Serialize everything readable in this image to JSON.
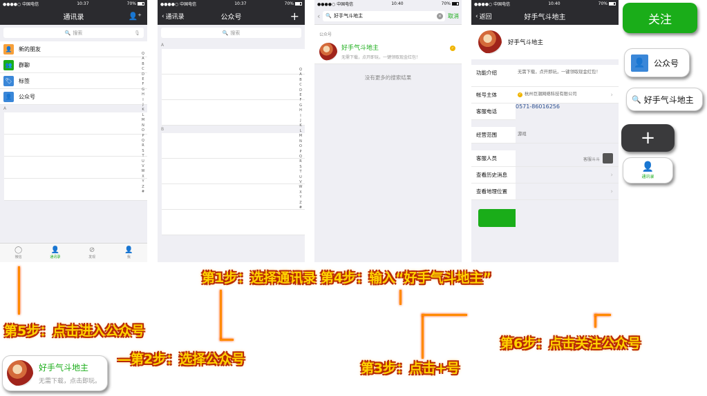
{
  "status": {
    "carrier": "●●●●○ 中国电信",
    "time1": "10:37",
    "time3": "10:40",
    "battery": "70%"
  },
  "screen1": {
    "title": "通讯录",
    "search_placeholder": "搜索",
    "rows": [
      {
        "label": "新的朋友",
        "color": "#f7a03a",
        "icon": "person-plus-icon",
        "glyph": "👤"
      },
      {
        "label": "群聊",
        "color": "#1aad19",
        "icon": "group-icon",
        "glyph": "👥"
      },
      {
        "label": "标签",
        "color": "#3a87d8",
        "icon": "tag-icon",
        "glyph": "🏷"
      },
      {
        "label": "公众号",
        "color": "#3a87d8",
        "icon": "official-account-icon",
        "glyph": "👤"
      }
    ],
    "section_a": "A",
    "alpha_index": [
      "Q",
      "A",
      "B",
      "C",
      "D",
      "E",
      "F",
      "G",
      "H",
      "I",
      "J",
      "K",
      "L",
      "M",
      "N",
      "O",
      "P",
      "Q",
      "R",
      "S",
      "T",
      "U",
      "V",
      "W",
      "X",
      "Y",
      "Z",
      "#"
    ],
    "tabs": [
      {
        "label": "微信",
        "icon": "chat-bubble-icon",
        "glyph": "◯"
      },
      {
        "label": "通讯录",
        "icon": "contacts-icon",
        "glyph": "👤"
      },
      {
        "label": "发现",
        "icon": "compass-icon",
        "glyph": "⊘"
      },
      {
        "label": "我",
        "icon": "me-icon",
        "glyph": "👤"
      }
    ]
  },
  "screen2": {
    "back": "通讯录",
    "title": "公众号",
    "add": "+",
    "search_placeholder": "搜索",
    "section_a": "A",
    "section_b": "B",
    "alpha_index": [
      "Q",
      "A",
      "B",
      "C",
      "D",
      "E",
      "F",
      "G",
      "H",
      "I",
      "J",
      "K",
      "L",
      "M",
      "N",
      "O",
      "P",
      "Q",
      "R",
      "S",
      "T",
      "U",
      "V",
      "W",
      "X",
      "Y",
      "Z",
      "#"
    ]
  },
  "screen3": {
    "query": "好手气斗地主",
    "cancel": "取消",
    "section": "公众号",
    "result_title": "好手气斗地主",
    "result_desc": "无需下载，点开即玩，一键领取现金红包！",
    "no_more": "没有更多的搜索结果"
  },
  "screen4": {
    "back": "返回",
    "title": "好手气斗地主",
    "name": "好手气斗地主",
    "rows": {
      "intro_label": "功能介绍",
      "intro_value": "无需下载，点开即玩，一键领取现金红包！",
      "owner_label": "帐号主体",
      "owner_value": "杭州巨潮网络科技有限公司",
      "phone_label": "客服电话",
      "phone_value": "0571-86016256",
      "scope_label": "经营范围",
      "scope_value": "游戏",
      "staff_label": "客服人员",
      "staff_value": "客服斗斗",
      "history_label": "查看历史消息",
      "location_label": "查看地理位置"
    },
    "follow": "关注"
  },
  "callouts": {
    "follow": "关注",
    "official": "公众号",
    "search": "好手气斗地主",
    "plus": "+",
    "contacts": "通讯录",
    "card_title": "好手气斗地主",
    "card_desc": "无需下载，点击即玩。"
  },
  "steps": {
    "s1_s4": "第1步：选择通讯录  第4步：输入“好手气斗地主”",
    "s5": "第5步：点击进入公众号",
    "s2": "—第2步：选择公众号",
    "s3": "第3步：点击+号",
    "s6": "第6步：点击关注公众号"
  }
}
